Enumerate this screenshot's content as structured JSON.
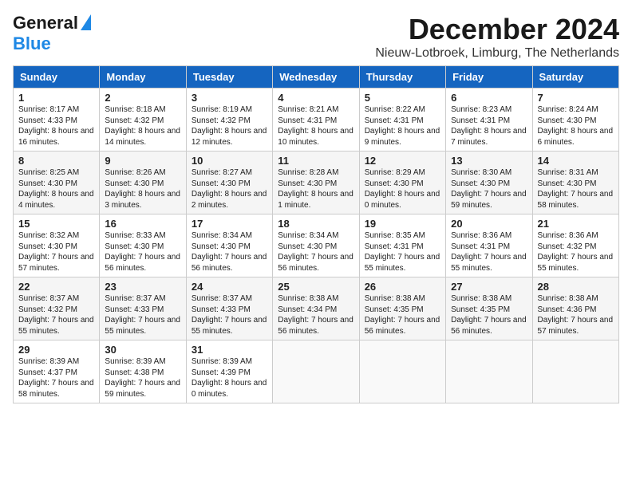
{
  "header": {
    "logo_general": "General",
    "logo_blue": "Blue",
    "month_title": "December 2024",
    "location": "Nieuw-Lotbroek, Limburg, The Netherlands"
  },
  "weekdays": [
    "Sunday",
    "Monday",
    "Tuesday",
    "Wednesday",
    "Thursday",
    "Friday",
    "Saturday"
  ],
  "weeks": [
    [
      {
        "day": "1",
        "sunrise": "Sunrise: 8:17 AM",
        "sunset": "Sunset: 4:33 PM",
        "daylight": "Daylight: 8 hours and 16 minutes."
      },
      {
        "day": "2",
        "sunrise": "Sunrise: 8:18 AM",
        "sunset": "Sunset: 4:32 PM",
        "daylight": "Daylight: 8 hours and 14 minutes."
      },
      {
        "day": "3",
        "sunrise": "Sunrise: 8:19 AM",
        "sunset": "Sunset: 4:32 PM",
        "daylight": "Daylight: 8 hours and 12 minutes."
      },
      {
        "day": "4",
        "sunrise": "Sunrise: 8:21 AM",
        "sunset": "Sunset: 4:31 PM",
        "daylight": "Daylight: 8 hours and 10 minutes."
      },
      {
        "day": "5",
        "sunrise": "Sunrise: 8:22 AM",
        "sunset": "Sunset: 4:31 PM",
        "daylight": "Daylight: 8 hours and 9 minutes."
      },
      {
        "day": "6",
        "sunrise": "Sunrise: 8:23 AM",
        "sunset": "Sunset: 4:31 PM",
        "daylight": "Daylight: 8 hours and 7 minutes."
      },
      {
        "day": "7",
        "sunrise": "Sunrise: 8:24 AM",
        "sunset": "Sunset: 4:30 PM",
        "daylight": "Daylight: 8 hours and 6 minutes."
      }
    ],
    [
      {
        "day": "8",
        "sunrise": "Sunrise: 8:25 AM",
        "sunset": "Sunset: 4:30 PM",
        "daylight": "Daylight: 8 hours and 4 minutes."
      },
      {
        "day": "9",
        "sunrise": "Sunrise: 8:26 AM",
        "sunset": "Sunset: 4:30 PM",
        "daylight": "Daylight: 8 hours and 3 minutes."
      },
      {
        "day": "10",
        "sunrise": "Sunrise: 8:27 AM",
        "sunset": "Sunset: 4:30 PM",
        "daylight": "Daylight: 8 hours and 2 minutes."
      },
      {
        "day": "11",
        "sunrise": "Sunrise: 8:28 AM",
        "sunset": "Sunset: 4:30 PM",
        "daylight": "Daylight: 8 hours and 1 minute."
      },
      {
        "day": "12",
        "sunrise": "Sunrise: 8:29 AM",
        "sunset": "Sunset: 4:30 PM",
        "daylight": "Daylight: 8 hours and 0 minutes."
      },
      {
        "day": "13",
        "sunrise": "Sunrise: 8:30 AM",
        "sunset": "Sunset: 4:30 PM",
        "daylight": "Daylight: 7 hours and 59 minutes."
      },
      {
        "day": "14",
        "sunrise": "Sunrise: 8:31 AM",
        "sunset": "Sunset: 4:30 PM",
        "daylight": "Daylight: 7 hours and 58 minutes."
      }
    ],
    [
      {
        "day": "15",
        "sunrise": "Sunrise: 8:32 AM",
        "sunset": "Sunset: 4:30 PM",
        "daylight": "Daylight: 7 hours and 57 minutes."
      },
      {
        "day": "16",
        "sunrise": "Sunrise: 8:33 AM",
        "sunset": "Sunset: 4:30 PM",
        "daylight": "Daylight: 7 hours and 56 minutes."
      },
      {
        "day": "17",
        "sunrise": "Sunrise: 8:34 AM",
        "sunset": "Sunset: 4:30 PM",
        "daylight": "Daylight: 7 hours and 56 minutes."
      },
      {
        "day": "18",
        "sunrise": "Sunrise: 8:34 AM",
        "sunset": "Sunset: 4:30 PM",
        "daylight": "Daylight: 7 hours and 56 minutes."
      },
      {
        "day": "19",
        "sunrise": "Sunrise: 8:35 AM",
        "sunset": "Sunset: 4:31 PM",
        "daylight": "Daylight: 7 hours and 55 minutes."
      },
      {
        "day": "20",
        "sunrise": "Sunrise: 8:36 AM",
        "sunset": "Sunset: 4:31 PM",
        "daylight": "Daylight: 7 hours and 55 minutes."
      },
      {
        "day": "21",
        "sunrise": "Sunrise: 8:36 AM",
        "sunset": "Sunset: 4:32 PM",
        "daylight": "Daylight: 7 hours and 55 minutes."
      }
    ],
    [
      {
        "day": "22",
        "sunrise": "Sunrise: 8:37 AM",
        "sunset": "Sunset: 4:32 PM",
        "daylight": "Daylight: 7 hours and 55 minutes."
      },
      {
        "day": "23",
        "sunrise": "Sunrise: 8:37 AM",
        "sunset": "Sunset: 4:33 PM",
        "daylight": "Daylight: 7 hours and 55 minutes."
      },
      {
        "day": "24",
        "sunrise": "Sunrise: 8:37 AM",
        "sunset": "Sunset: 4:33 PM",
        "daylight": "Daylight: 7 hours and 55 minutes."
      },
      {
        "day": "25",
        "sunrise": "Sunrise: 8:38 AM",
        "sunset": "Sunset: 4:34 PM",
        "daylight": "Daylight: 7 hours and 56 minutes."
      },
      {
        "day": "26",
        "sunrise": "Sunrise: 8:38 AM",
        "sunset": "Sunset: 4:35 PM",
        "daylight": "Daylight: 7 hours and 56 minutes."
      },
      {
        "day": "27",
        "sunrise": "Sunrise: 8:38 AM",
        "sunset": "Sunset: 4:35 PM",
        "daylight": "Daylight: 7 hours and 56 minutes."
      },
      {
        "day": "28",
        "sunrise": "Sunrise: 8:38 AM",
        "sunset": "Sunset: 4:36 PM",
        "daylight": "Daylight: 7 hours and 57 minutes."
      }
    ],
    [
      {
        "day": "29",
        "sunrise": "Sunrise: 8:39 AM",
        "sunset": "Sunset: 4:37 PM",
        "daylight": "Daylight: 7 hours and 58 minutes."
      },
      {
        "day": "30",
        "sunrise": "Sunrise: 8:39 AM",
        "sunset": "Sunset: 4:38 PM",
        "daylight": "Daylight: 7 hours and 59 minutes."
      },
      {
        "day": "31",
        "sunrise": "Sunrise: 8:39 AM",
        "sunset": "Sunset: 4:39 PM",
        "daylight": "Daylight: 8 hours and 0 minutes."
      },
      null,
      null,
      null,
      null
    ]
  ]
}
